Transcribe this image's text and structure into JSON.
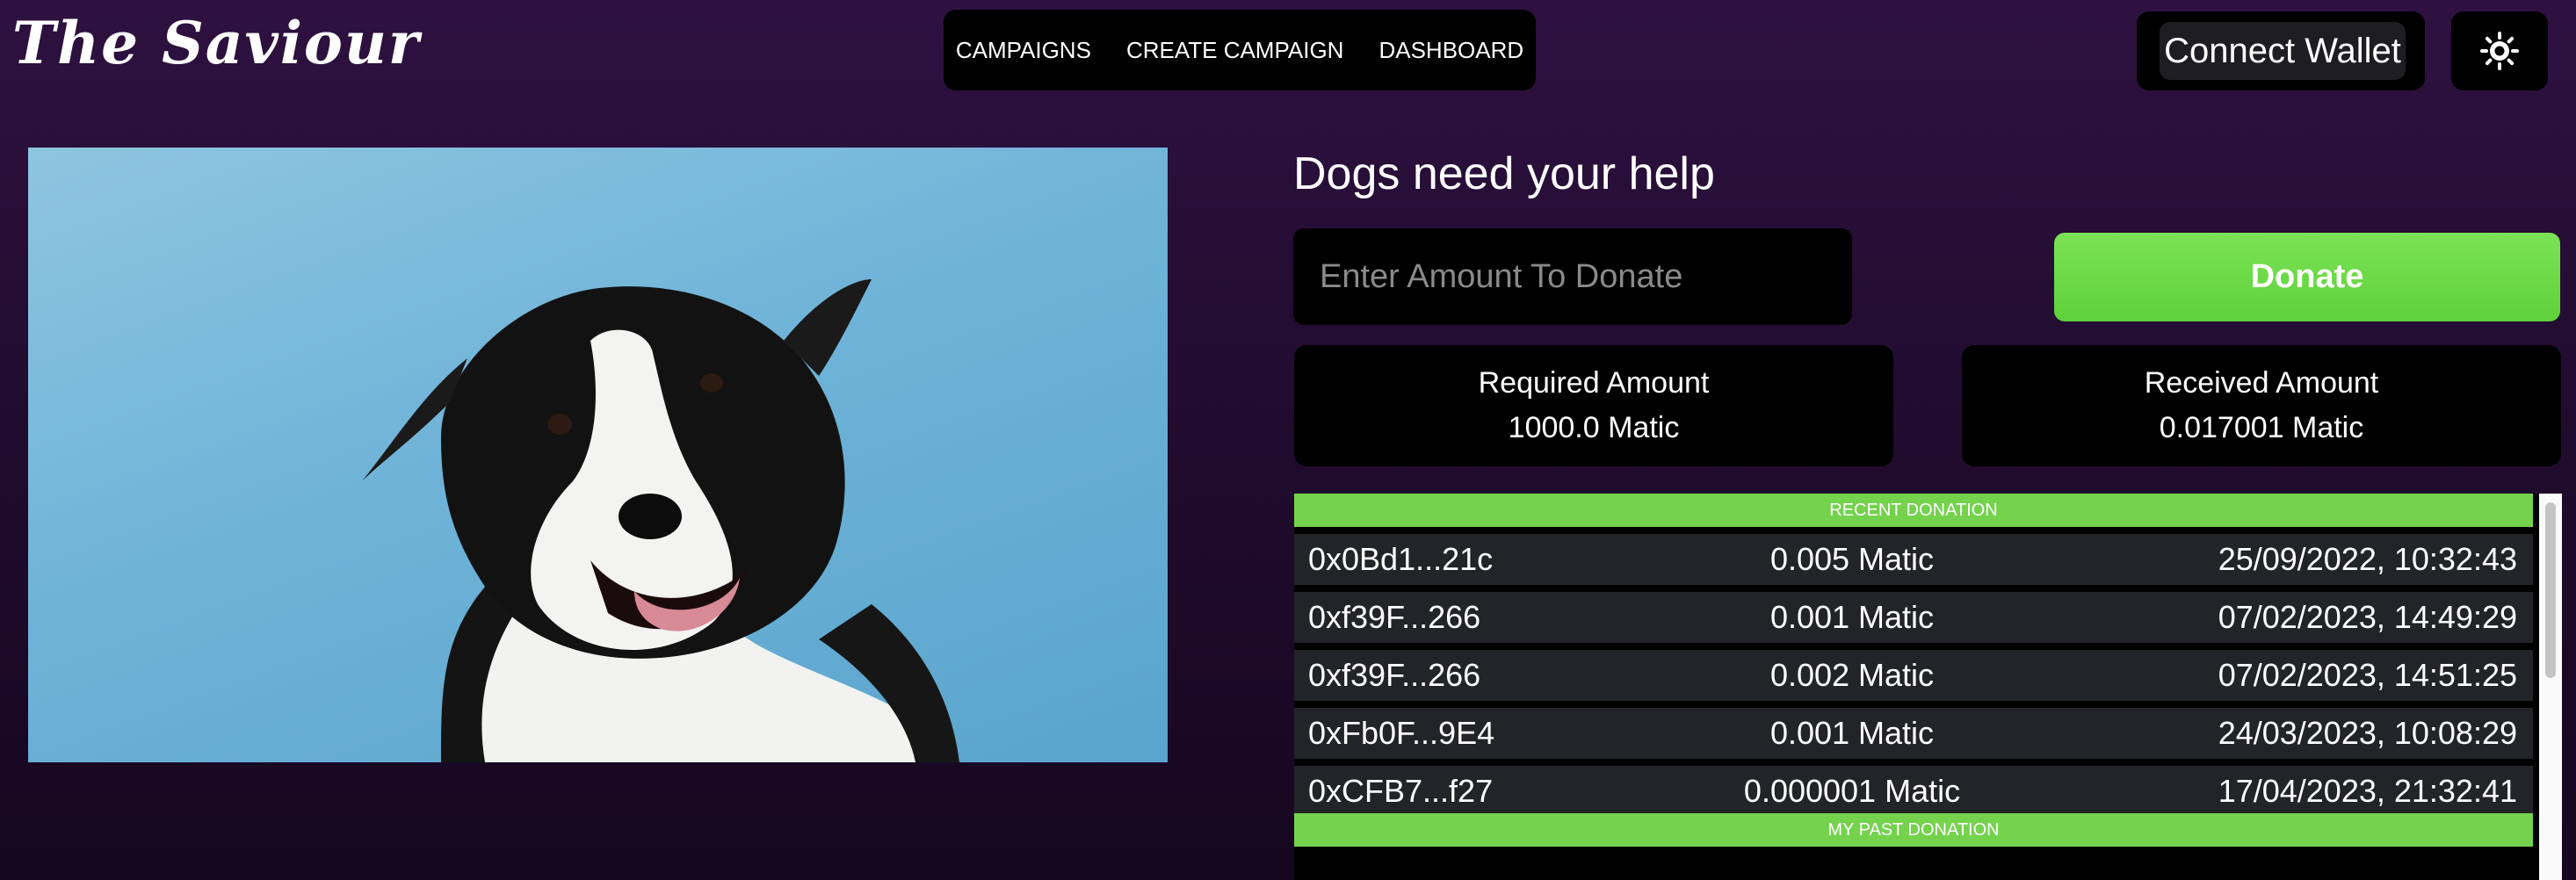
{
  "brand": {
    "logo_text": "The Saviour"
  },
  "nav": {
    "items": [
      {
        "label": "CAMPAIGNS"
      },
      {
        "label": "CREATE CAMPAIGN"
      },
      {
        "label": "DASHBOARD"
      }
    ]
  },
  "header": {
    "wallet_label": "Connect Wallet",
    "theme_icon": "sun-icon"
  },
  "campaign": {
    "image_subject": "border-collie-dog",
    "title": "Dogs need your help",
    "donate_placeholder": "Enter Amount To Donate",
    "donate_label": "Donate",
    "required": {
      "label": "Required Amount",
      "value": "1000.0 Matic"
    },
    "received": {
      "label": "Received Amount",
      "value": "0.017001 Matic"
    }
  },
  "recent_donations": {
    "header": "RECENT DONATION",
    "rows": [
      {
        "address": "0x0Bd1...21c",
        "amount": "0.005 Matic",
        "date": "25/09/2022, 10:32:43"
      },
      {
        "address": "0xf39F...266",
        "amount": "0.001 Matic",
        "date": "07/02/2023, 14:49:29"
      },
      {
        "address": "0xf39F...266",
        "amount": "0.002 Matic",
        "date": "07/02/2023, 14:51:25"
      },
      {
        "address": "0xFb0F...9E4",
        "amount": "0.001 Matic",
        "date": "24/03/2023, 10:08:29"
      },
      {
        "address": "0xCFB7...f27",
        "amount": "0.000001 Matic",
        "date": "17/04/2023, 21:32:41"
      }
    ]
  },
  "past_donations": {
    "header": "MY PAST DONATION"
  },
  "colors": {
    "background": "#2e1140",
    "accent_green": "#74d24d",
    "panel": "#000000",
    "row": "#232428"
  }
}
